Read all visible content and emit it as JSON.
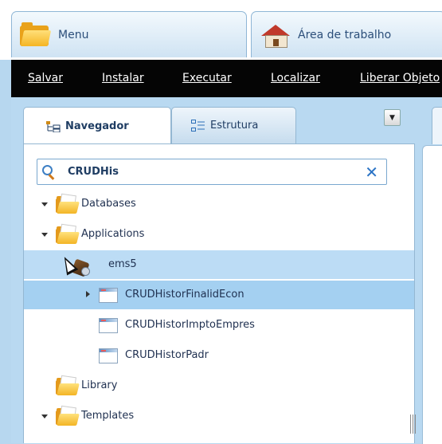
{
  "top_tabs": {
    "menu_label": "Menu",
    "area_label": "Área de trabalho"
  },
  "menubar": {
    "items": [
      "Salvar",
      "Instalar",
      "Executar",
      "Localizar",
      "Liberar Objeto"
    ]
  },
  "navigator": {
    "tabs": [
      {
        "label": "Navegador",
        "active": true,
        "icon": "navigator-tree-icon"
      },
      {
        "label": "Estrutura",
        "active": false,
        "icon": "structure-icon"
      }
    ],
    "search": {
      "value": "CRUDHis",
      "clear_symbol": "✕"
    },
    "tree": [
      {
        "label": "Databases",
        "icon": "folder-icon",
        "expanded": true
      },
      {
        "label": "Applications",
        "icon": "folder-icon",
        "expanded": true
      },
      {
        "label": "ems5",
        "icon": "application-icon",
        "selected": true
      },
      {
        "label": "CRUDHistorFinalidEcon",
        "icon": "form-icon",
        "selected": true,
        "collapsed": true
      },
      {
        "label": "CRUDHistorImptoEmpres",
        "icon": "form-icon"
      },
      {
        "label": "CRUDHistorPadr",
        "icon": "form-icon"
      },
      {
        "label": "Library",
        "icon": "folder-icon"
      },
      {
        "label": "Templates",
        "icon": "folder-icon",
        "expanded": true
      }
    ]
  },
  "colors": {
    "menubar_bg": "#050505",
    "selection_primary": "#a4d0f1",
    "selection_secondary": "#bcdcf5",
    "accent": "#2a73c5"
  }
}
